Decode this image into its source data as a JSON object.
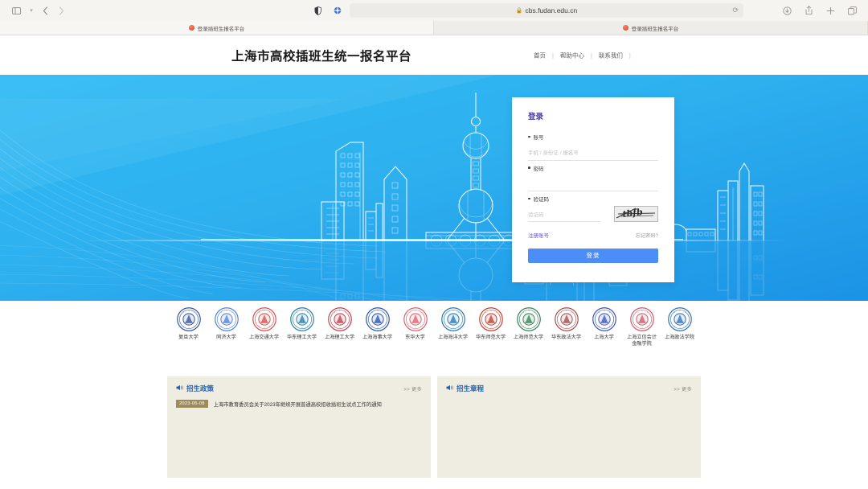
{
  "browser": {
    "url": "cbs.fudan.edu.cn",
    "lock_icon": "lock-icon",
    "reload_icon": "reload-icon",
    "sidebar_icon": "sidebar-toggle-icon",
    "chevron_icon": "chevron-down-icon",
    "back_icon": "back-arrow-icon",
    "forward_icon": "forward-arrow-icon",
    "shield_icon": "shield-icon",
    "extension_icon": "extension-icon",
    "downloads_icon": "downloads-icon",
    "share_icon": "share-icon",
    "new_tab_icon": "plus-icon",
    "tabs_overview_icon": "tab-overview-icon",
    "tabs": [
      {
        "title": "登录插班生报名平台",
        "active": true
      },
      {
        "title": "登录插班生报名平台",
        "active": false
      }
    ]
  },
  "header": {
    "site_title": "上海市高校插班生统一报名平台",
    "nav": [
      {
        "label": "首页"
      },
      {
        "label": "帮助中心"
      },
      {
        "label": "联系我们"
      }
    ],
    "nav_separator": "|"
  },
  "login": {
    "title": "登录",
    "account_label": "账号",
    "account_placeholder": "手机 / 身份证 / 报名号",
    "account_value": "",
    "password_label": "密码",
    "password_placeholder": "",
    "password_value": "",
    "captcha_label": "验证码",
    "captcha_placeholder": "验证码",
    "captcha_value": "",
    "captcha_image_alt": "captcha-image",
    "register_link": "注册账号",
    "forgot_link": "忘记密码?",
    "submit_label": "登录",
    "accent_color": "#4c8ef7",
    "title_color": "#4a3f9e",
    "link_color": "#6a4fd1"
  },
  "hero": {
    "alt": "上海城市天际线",
    "gradient_from": "#2fb9f2",
    "gradient_to": "#1a96e6"
  },
  "universities": [
    {
      "name": "复旦大学",
      "color": "#2f4f9e",
      "ring": "#2f4f9e"
    },
    {
      "name": "同济大学",
      "color": "#4b7fd4",
      "ring": "#4b7fd4"
    },
    {
      "name": "上海交通大学",
      "color": "#d24b4b",
      "ring": "#d24b4b"
    },
    {
      "name": "华东理工大学",
      "color": "#1f7aa8",
      "ring": "#1f7aa8"
    },
    {
      "name": "上海理工大学",
      "color": "#c03a4a",
      "ring": "#c03a4a"
    },
    {
      "name": "上海海事大学",
      "color": "#2050b0",
      "ring": "#2050b0"
    },
    {
      "name": "东华大学",
      "color": "#e05a6a",
      "ring": "#e05a6a"
    },
    {
      "name": "上海海洋大学",
      "color": "#1d74b8",
      "ring": "#1d74b8"
    },
    {
      "name": "华东师范大学",
      "color": "#c0392b",
      "ring": "#c0392b"
    },
    {
      "name": "上海师范大学",
      "color": "#2f7d4f",
      "ring": "#2f7d4f"
    },
    {
      "name": "华东政法大学",
      "color": "#9e4a4a",
      "ring": "#9e4a4a"
    },
    {
      "name": "上海大学",
      "color": "#3550b8",
      "ring": "#3550b8"
    },
    {
      "name": "上海立信会计金融学院",
      "color": "#c4576a",
      "ring": "#c4576a"
    },
    {
      "name": "上海政法学院",
      "color": "#2b6bb5",
      "ring": "#2b6bb5"
    }
  ],
  "news_panels": [
    {
      "title": "招生政策",
      "more_label": ">> 更多",
      "icon": "megaphone-icon",
      "items": [
        {
          "date": "2023-05-08",
          "text": "上海市教育委员会关于2023年继续开展普通高校招收插班生试点工作的通知"
        }
      ]
    },
    {
      "title": "招生章程",
      "more_label": ">> 更多",
      "icon": "megaphone-icon",
      "items": []
    }
  ],
  "colors": {
    "panel_bg": "#efece1",
    "news_title": "#1f64b4",
    "date_badge": "#9d8b5b"
  }
}
